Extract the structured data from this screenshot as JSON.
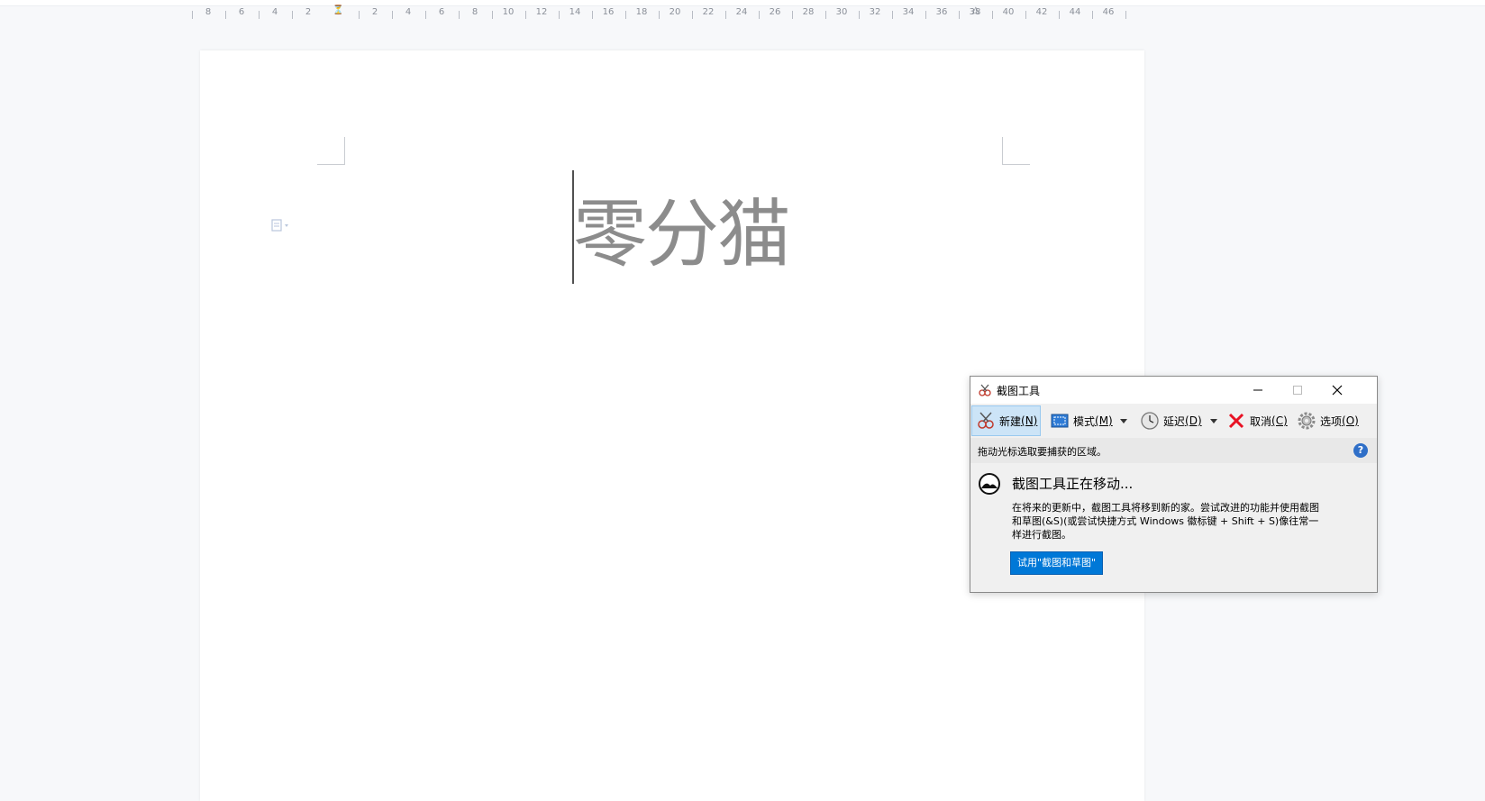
{
  "ruler": {
    "left_numbers": [
      "8",
      "6",
      "4",
      "2"
    ],
    "right_numbers": [
      "2",
      "4",
      "6",
      "8",
      "10",
      "12",
      "14",
      "16",
      "18",
      "20",
      "22",
      "24",
      "26",
      "28",
      "30",
      "32",
      "34",
      "36",
      "38",
      "40",
      "42",
      "44",
      "46"
    ]
  },
  "document": {
    "text": "零分猫"
  },
  "snipping_tool": {
    "title": "截图工具",
    "toolbar": {
      "new_label": "新建",
      "new_key": "(N)",
      "mode_label": "模式",
      "mode_key": "(M)",
      "delay_label": "延迟",
      "delay_key": "(D)",
      "cancel_label": "取消",
      "cancel_key": "(C)",
      "options_label": "选项",
      "options_key": "(O)"
    },
    "status": "拖动光标选取要捕获的区域。",
    "help": "?",
    "promo": {
      "heading": "截图工具正在移动...",
      "body": "在将来的更新中，截图工具将移到新的家。尝试改进的功能并使用截图和草图(&S)(或尝试快捷方式 Windows 徽标键 + Shift + S)像往常一样进行截图。",
      "button": "试用\"截图和草图\""
    }
  },
  "colors": {
    "accent": "#0078d7",
    "active_toolbar": "#cce4f7",
    "doc_text": "#8c8c8c",
    "cancel_red": "#e81123"
  }
}
